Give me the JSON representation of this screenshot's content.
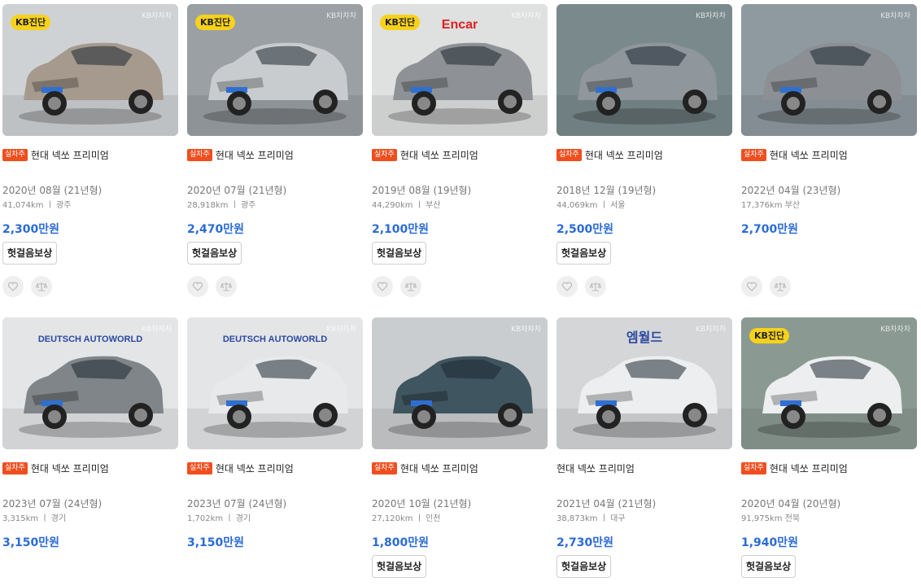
{
  "watermark": "KB차차차",
  "badge_label": "실차주",
  "kb_label": "KB진단",
  "pill_label": "헛걸음보상",
  "cards": [
    {
      "title": "현대 넥쏘 프리미엄",
      "year": "2020년 08월 (21년형)",
      "meta": "41,074km ㅣ 광주",
      "price": "2,300만원",
      "badge": true,
      "kb": true,
      "pill": true,
      "icons": true,
      "car_color": "#a69a8e",
      "bg": "#cfd2d4"
    },
    {
      "title": "현대 넥쏘 프리미엄",
      "year": "2020년 07월 (21년형)",
      "meta": "28,918km ㅣ 광주",
      "price": "2,470만원",
      "badge": true,
      "kb": true,
      "pill": true,
      "icons": true,
      "car_color": "#c9ccce",
      "bg": "#9aa0a4"
    },
    {
      "title": "현대 넥쏘 프리미엄",
      "year": "2019년 08월 (19년형)",
      "meta": "44,290km ㅣ 부산",
      "price": "2,100만원",
      "badge": true,
      "kb": true,
      "pill": true,
      "icons": true,
      "car_color": "#8e9296",
      "bg": "#dfe0e0",
      "brand_text": "Encar"
    },
    {
      "title": "현대 넥쏘 프리미엄",
      "year": "2018년 12월 (19년형)",
      "meta": "44,069km ㅣ 서울",
      "price": "2,500만원",
      "badge": true,
      "kb": false,
      "pill": true,
      "icons": true,
      "car_color": "#8f969c",
      "bg": "#7a8a8c"
    },
    {
      "title": "현대 넥쏘 프리미엄",
      "year": "2022년 04월 (23년형)",
      "meta": "17,376km    부산",
      "price": "2,700만원",
      "badge": true,
      "kb": false,
      "pill": false,
      "icons": true,
      "car_color": "#8c9094",
      "bg": "#8f9aa0"
    },
    {
      "title": "현대 넥쏘 프리미엄",
      "year": "2023년 07월 (24년형)",
      "meta": "3,315km ㅣ 경기",
      "price": "3,150만원",
      "badge": true,
      "kb": false,
      "pill": false,
      "icons": false,
      "car_color": "#7f8589",
      "bg": "#e3e5e7",
      "brand_text": "DEUTSCH AUTOWORLD"
    },
    {
      "title": "현대 넥쏘 프리미엄",
      "year": "2023년 07월 (24년형)",
      "meta": "1,702km ㅣ 경기",
      "price": "3,150만원",
      "badge": true,
      "kb": false,
      "pill": false,
      "icons": false,
      "car_color": "#e7e9eb",
      "bg": "#e3e5e7",
      "brand_text": "DEUTSCH AUTOWORLD"
    },
    {
      "title": "현대 넥쏘 프리미엄",
      "year": "2020년 10월 (21년형)",
      "meta": "27,120km ㅣ 인천",
      "price": "1,800만원",
      "badge": true,
      "kb": false,
      "pill": true,
      "icons": false,
      "car_color": "#3f5560",
      "bg": "#cacdcf"
    },
    {
      "title": "현대 넥쏘 프리미엄",
      "year": "2021년 04월 (21년형)",
      "meta": "38,873km ㅣ 대구",
      "price": "2,730만원",
      "badge": false,
      "kb": false,
      "pill": true,
      "icons": false,
      "car_color": "#eceeef",
      "bg": "#d4d6d8",
      "brand_text": "엠월드"
    },
    {
      "title": "현대 넥쏘 프리미엄",
      "year": "2020년 04월 (20년형)",
      "meta": "91,975km    전북",
      "price": "1,940만원",
      "badge": true,
      "kb": true,
      "pill": true,
      "icons": false,
      "car_color": "#eceeef",
      "bg": "#8a9a92"
    }
  ]
}
